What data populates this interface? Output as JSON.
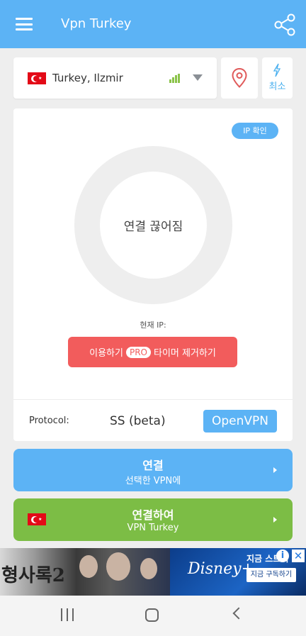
{
  "appbar": {
    "title": "Vpn Turkey",
    "menu_icon": "menu-icon",
    "share_icon": "share-icon"
  },
  "location": {
    "name": "Turkey, Ilzmir",
    "flag": "turkey-flag",
    "signal_icon": "signal-icon",
    "dropdown_icon": "chevron-down-icon"
  },
  "location_pin": {
    "icon": "location-pin-icon"
  },
  "fastest": {
    "icon": "bolt-icon",
    "label": "최소"
  },
  "status": {
    "ip_check_label": "IP 확인",
    "state_label": "연결 끊어짐",
    "current_ip_label": "현재 IP:"
  },
  "promo": {
    "prefix": "이용하기",
    "badge": "PRO",
    "suffix": "타이머 제거하기"
  },
  "protocol": {
    "label": "Protocol:",
    "current": "SS (beta)",
    "alternative": "OpenVPN"
  },
  "connect_selected": {
    "title": "연결",
    "subtitle": "선택한 VPN에"
  },
  "connect_country": {
    "title": "연결하여",
    "subtitle": "VPN Turkey"
  },
  "ad": {
    "title": "형사록2",
    "brand": "Disney+",
    "headline": "지금 스트리",
    "cta": "지금 구독하기"
  },
  "colors": {
    "primary": "#5cb3f5",
    "danger": "#f25c5c",
    "success": "#7cbd45"
  }
}
